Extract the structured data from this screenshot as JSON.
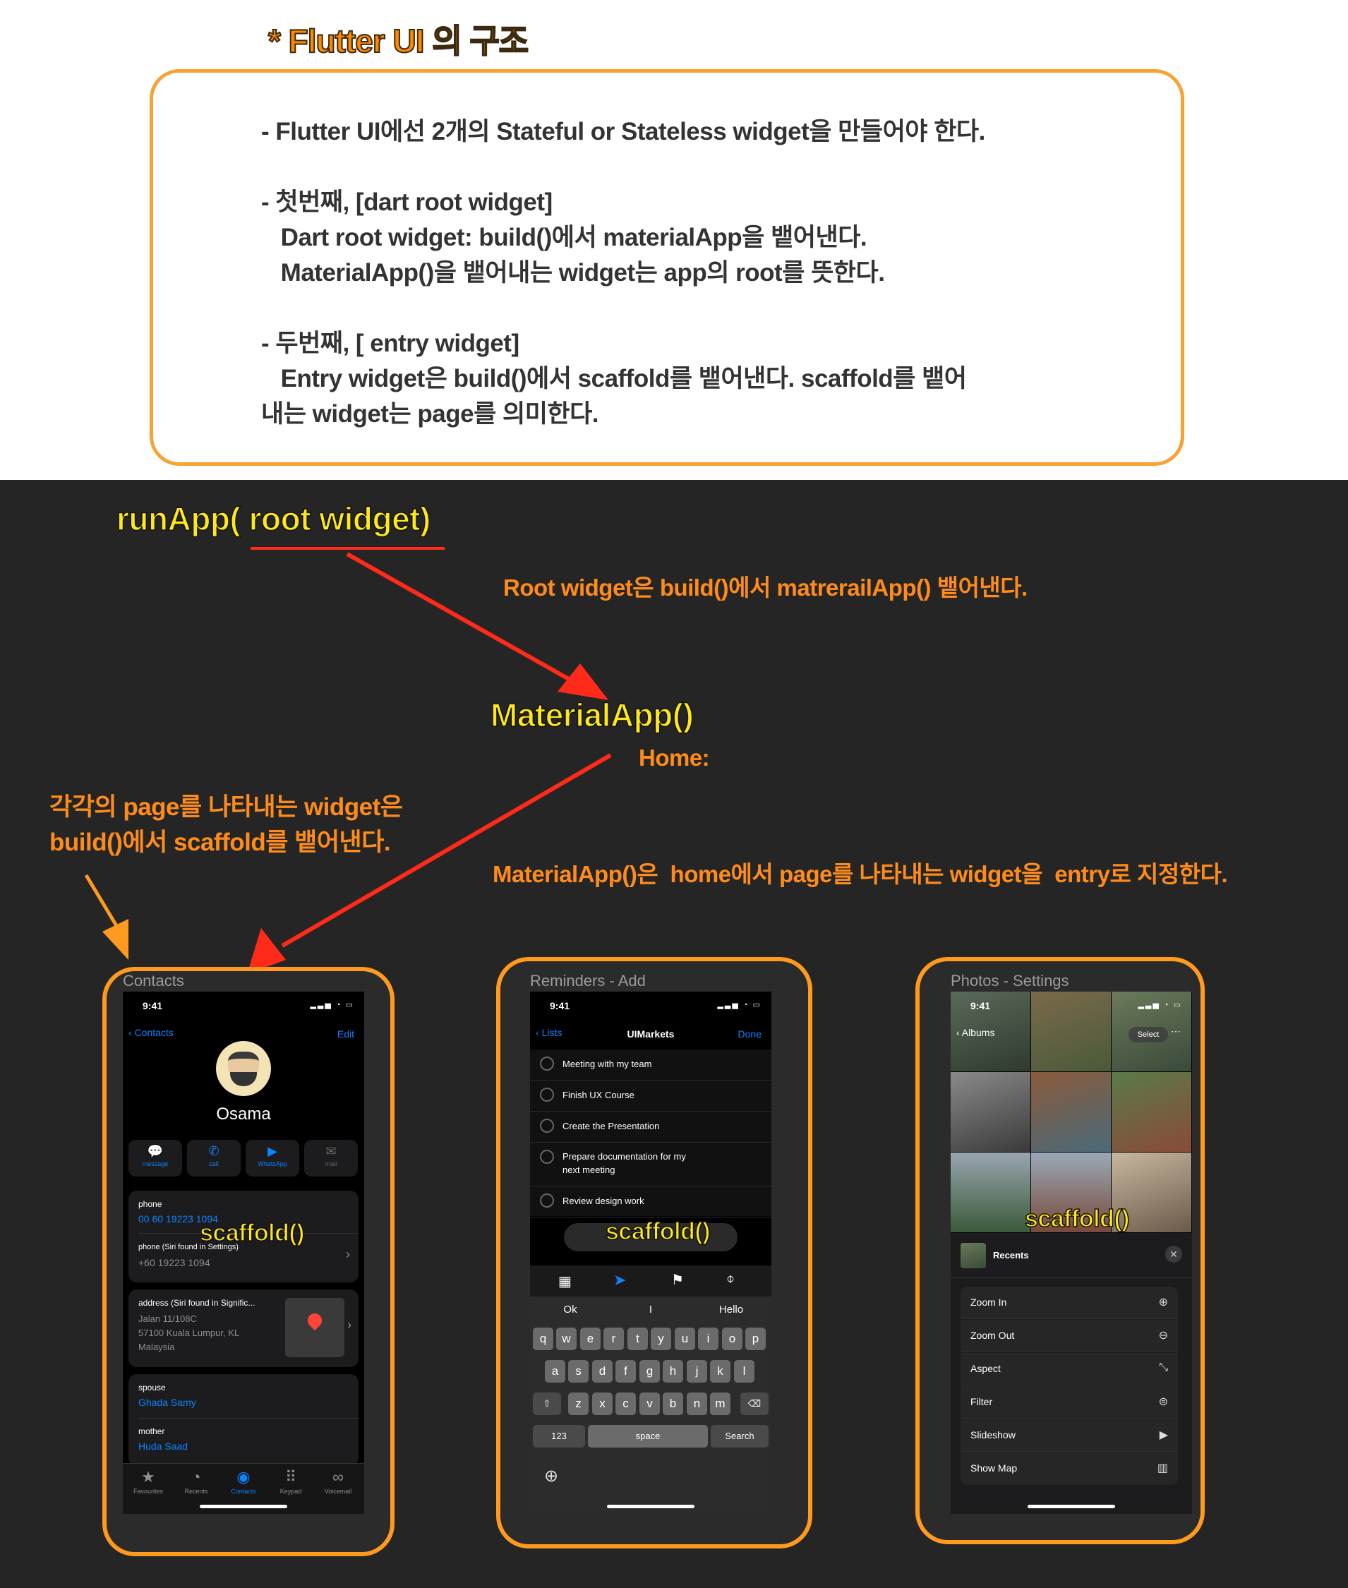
{
  "title": "* Flutter UI 의 구조",
  "note": {
    "line1": "- Flutter UI에선 2개의 Stateful or Stateless widget을 만들어야 한다.",
    "line2": "- 첫번째, [dart root widget]",
    "line3": "   Dart root widget: build()에서 materialApp을 뱉어낸다.",
    "line4": "   MaterialApp()을 뱉어내는 widget는 app의 root를 뜻한다.",
    "line5": "- 두번째, [ entry widget]",
    "line6": "   Entry widget은 build()에서 scaffold를 뱉어낸다. scaffold를 뱉어",
    "line7": "내는 widget는 page를 의미한다."
  },
  "diagram": {
    "runapp": "runApp( root widget)",
    "root_caption": "Root widget은 build()에서 matrerailApp() 뱉어낸다.",
    "material": "MaterialApp()",
    "home": "Home:",
    "page_caption1": "각각의 page를 나타내는 widget은",
    "page_caption2": "build()에서 scaffold를 뱉어낸다.",
    "home_caption": "MaterialApp()은  home에서 page를 나타내는 widget을  entry로 지정한다.",
    "scaffold": "scaffold()"
  },
  "colors": {
    "accent": "#ff9a1f",
    "highlight": "#ffe81a",
    "arrow": "#ff2a1a",
    "ios_blue": "#0a84ff"
  },
  "contacts": {
    "frame_label": "Contacts",
    "time": "9:41",
    "back": "Contacts",
    "edit": "Edit",
    "name": "Osama",
    "actions": [
      "message",
      "call",
      "WhatsApp",
      "mail"
    ],
    "phone_label": "phone",
    "phone_value": "00 60 19223 1094",
    "phone2_label": "phone (Siri found in Settings)",
    "phone2_value": "+60 19223 1094",
    "address_label": "address (Siri found in Signific...",
    "address_l1": "Jalan 11/108C",
    "address_l2": "57100 Kuala Lumpur, KL",
    "address_l3": "Malaysia",
    "spouse_label": "spouse",
    "spouse_value": "Ghada Samy",
    "mother_label": "mother",
    "mother_value": "Huda Saad",
    "tabs": [
      "Favourites",
      "Recents",
      "Contacts",
      "Keypad",
      "Voicemail"
    ]
  },
  "reminders": {
    "frame_label": "Reminders - Add",
    "time": "9:41",
    "back": "Lists",
    "title": "UIMarkets",
    "done": "Done",
    "items": [
      "Meeting with my team",
      "Finish UX Course",
      "Create the Presentation",
      "Prepare documentation for my",
      "Review design work"
    ],
    "item4_cont": "next meeting",
    "suggestions": [
      "Ok",
      "I",
      "Hello"
    ],
    "row1": [
      "q",
      "w",
      "e",
      "r",
      "t",
      "y",
      "u",
      "i",
      "o",
      "p"
    ],
    "row2": [
      "a",
      "s",
      "d",
      "f",
      "g",
      "h",
      "j",
      "k",
      "l"
    ],
    "row3": [
      "z",
      "x",
      "c",
      "v",
      "b",
      "n",
      "m"
    ],
    "num": "123",
    "space": "space",
    "search": "Search"
  },
  "photos": {
    "frame_label": "Photos - Settings",
    "time": "9:41",
    "back": "Albums",
    "select": "Select",
    "recents": "Recents",
    "menu": [
      "Zoom In",
      "Zoom Out",
      "Aspect",
      "Filter",
      "Slideshow",
      "Show Map"
    ]
  }
}
